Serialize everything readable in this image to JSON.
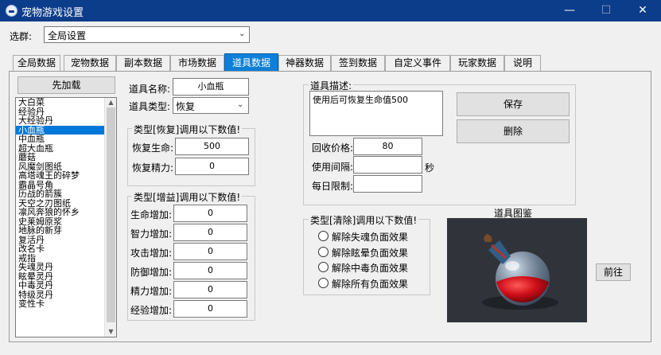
{
  "window": {
    "title": "宠物游戏设置",
    "min": "—",
    "max": "☐",
    "close": "✕"
  },
  "selector": {
    "label": "选群:",
    "value": "全局设置"
  },
  "tabs": [
    "全局数据",
    "宠物数据",
    "副本数据",
    "市场数据",
    "道具数据",
    "神器数据",
    "签到数据",
    "自定义事件",
    "玩家数据",
    "说明"
  ],
  "active_tab": "道具数据",
  "load_button": "先加载",
  "items": [
    "大白菜",
    "经验丹",
    "大经验丹",
    "小血瓶",
    "中血瓶",
    "超大血瓶",
    "蘑菇",
    "风魔剑图纸",
    "高塔魂王的碎梦",
    "霸晶号角",
    "历战的箭簇",
    "天空之刃图纸",
    "凛风奔狼的怀乡",
    "史莱姆原浆",
    "地脉的新芽",
    "复活丹",
    "改名卡",
    "戒指",
    "失魂灵丹",
    "眩晕灵丹",
    "中毒灵丹",
    "特级灵丹",
    "变性卡"
  ],
  "selected_item": "小血瓶",
  "item_name": {
    "label": "道具名称:",
    "value": "小血瓶"
  },
  "item_type": {
    "label": "道具类型:",
    "value": "恢复"
  },
  "restore_group": {
    "title": "类型[恢复]调用以下数值!",
    "fields": [
      {
        "label": "恢复生命:",
        "value": "500"
      },
      {
        "label": "恢复精力:",
        "value": "0"
      }
    ]
  },
  "buff_group": {
    "title": "类型[增益]调用以下数值!",
    "fields": [
      {
        "label": "生命增加:",
        "value": "0"
      },
      {
        "label": "智力增加:",
        "value": "0"
      },
      {
        "label": "攻击增加:",
        "value": "0"
      },
      {
        "label": "防御增加:",
        "value": "0"
      },
      {
        "label": "精力增加:",
        "value": "0"
      },
      {
        "label": "经验增加:",
        "value": "0"
      }
    ]
  },
  "description": {
    "label": "道具描述:",
    "value": "使用后可恢复生命值500"
  },
  "save_button": "保存",
  "delete_button": "删除",
  "recycle_price": {
    "label": "回收价格:",
    "value": "80"
  },
  "use_interval": {
    "label": "使用间隔:",
    "value": "",
    "unit": "秒"
  },
  "daily_limit": {
    "label": "每日限制:",
    "value": ""
  },
  "clear_group": {
    "title": "类型[清除]调用以下数值!",
    "options": [
      "解除失魂负面效果",
      "解除眩晕负面效果",
      "解除中毒负面效果",
      "解除所有负面效果"
    ]
  },
  "image_label": "道具图鉴",
  "goto_button": "前往"
}
